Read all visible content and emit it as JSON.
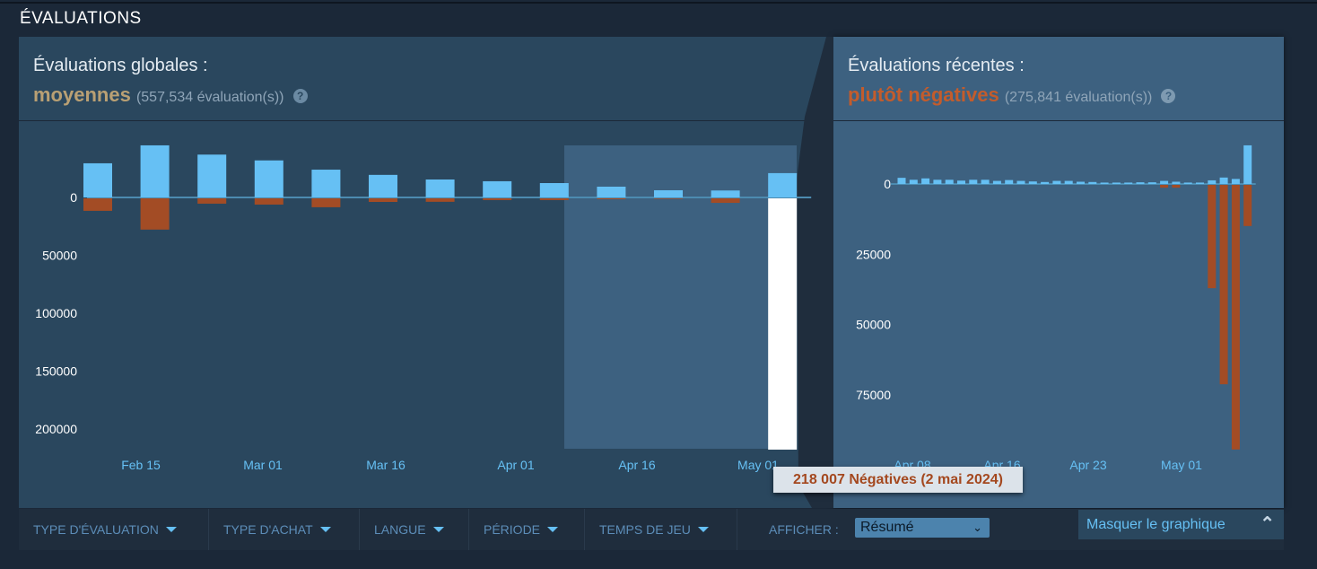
{
  "section_title": "ÉVALUATIONS",
  "overall": {
    "title": "Évaluations globales :",
    "rating": "moyennes",
    "count": "(557,534 évaluation(s))",
    "help": "?",
    "rating_color": "#b9a074"
  },
  "recent": {
    "title": "Évaluations récentes :",
    "rating": "plutôt négatives",
    "count": "(275,841 évaluation(s))",
    "help": "?",
    "rating_color": "#c35c2c"
  },
  "tooltip": "218 007 Négatives (2 mai 2024)",
  "filters": [
    {
      "label": "TYPE D'ÉVALUATION"
    },
    {
      "label": "TYPE D'ACHAT"
    },
    {
      "label": "LANGUE"
    },
    {
      "label": "PÉRIODE"
    },
    {
      "label": "TEMPS DE JEU"
    }
  ],
  "display": {
    "label": "AFFICHER :",
    "selected": "Résumé"
  },
  "hide_graph": "Masquer le graphique",
  "colors": {
    "positive": "#66c0f4",
    "negative": "#a34c25",
    "highlight": "#ffffff"
  },
  "chart_data": [
    {
      "type": "bar",
      "title": "",
      "y_ticks": [
        "0",
        "50000",
        "100000",
        "150000",
        "200000"
      ],
      "ylim": [
        0,
        218007
      ],
      "x_ticks": [
        "Feb 15",
        "Mar 01",
        "Mar 16",
        "Apr 01",
        "Apr 16",
        "May 01"
      ],
      "series": [
        {
          "values": [
            29500,
            45000,
            37000,
            32000,
            24000,
            19500,
            15500,
            14000,
            12400,
            9300,
            6200,
            6000,
            21000
          ]
        },
        {
          "values": [
            10800,
            27000,
            4600,
            5400,
            7700,
            3100,
            3000,
            1500,
            1500,
            800,
            500,
            3900,
            218007
          ]
        }
      ],
      "highlighted_bar": 12,
      "grid": false
    },
    {
      "type": "bar",
      "title": "",
      "y_ticks": [
        "0",
        "25000",
        "50000",
        "75000"
      ],
      "x_ticks": [
        "Apr 08",
        "Apr 16",
        "Apr 23",
        "May 01"
      ],
      "series": [
        {
          "values": [
            2200,
            1500,
            2000,
            1500,
            1500,
            1200,
            1500,
            1500,
            1100,
            1400,
            1100,
            900,
            700,
            1100,
            1100,
            800,
            700,
            500,
            500,
            500,
            600,
            600,
            1100,
            800,
            500,
            500,
            1300,
            2300,
            1800,
            13800
          ]
        },
        {
          "values": [
            0,
            0,
            0,
            0,
            0,
            0,
            0,
            0,
            0,
            0,
            0,
            0,
            0,
            0,
            0,
            0,
            0,
            0,
            0,
            0,
            0,
            0,
            1000,
            1000,
            0,
            0,
            36900,
            71200,
            94500,
            14700
          ]
        }
      ],
      "grid": false
    }
  ]
}
